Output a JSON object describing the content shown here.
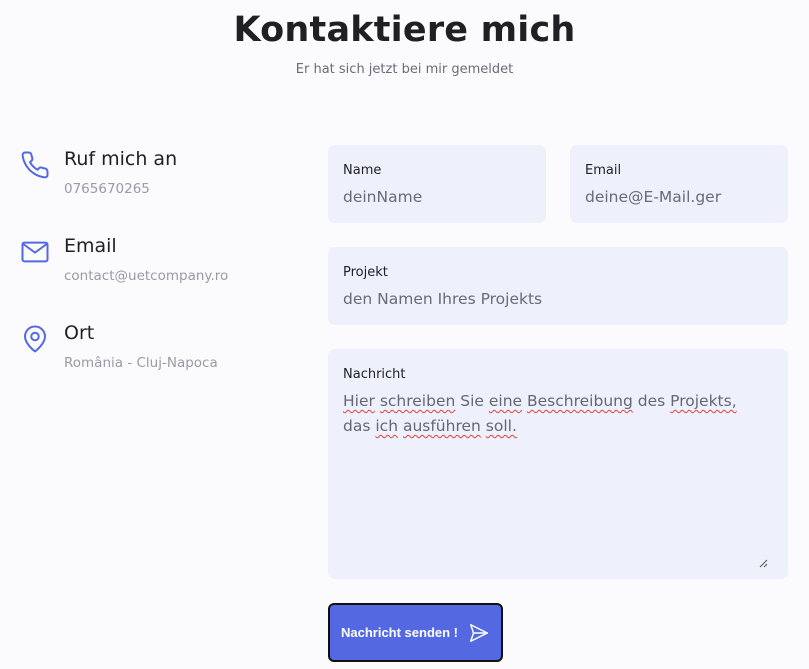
{
  "header": {
    "title": "Kontaktiere mich",
    "subtitle": "Er hat sich jetzt bei mir gemeldet"
  },
  "contact_info": [
    {
      "icon": "phone-icon",
      "heading": "Ruf mich an",
      "value": "0765670265"
    },
    {
      "icon": "mail-icon",
      "heading": "Email",
      "value": "contact@uetcompany.ro"
    },
    {
      "icon": "location-pin-icon",
      "heading": "Ort",
      "value": "România - Cluj-Napoca"
    }
  ],
  "form": {
    "name": {
      "label": "Name",
      "placeholder": "deinName"
    },
    "email": {
      "label": "Email",
      "placeholder": "deine@E-Mail.ger"
    },
    "project": {
      "label": "Projekt",
      "placeholder": "den Namen Ihres Projekts"
    },
    "message": {
      "label": "Nachricht",
      "placeholder": "Hier schreiben Sie eine Beschreibung des Projekts, das ich ausführen soll."
    },
    "submit_label": "Nachricht senden !"
  },
  "colors": {
    "accent": "#5468e2",
    "field_background": "#eef0fb",
    "page_background": "#fbfbfe"
  }
}
